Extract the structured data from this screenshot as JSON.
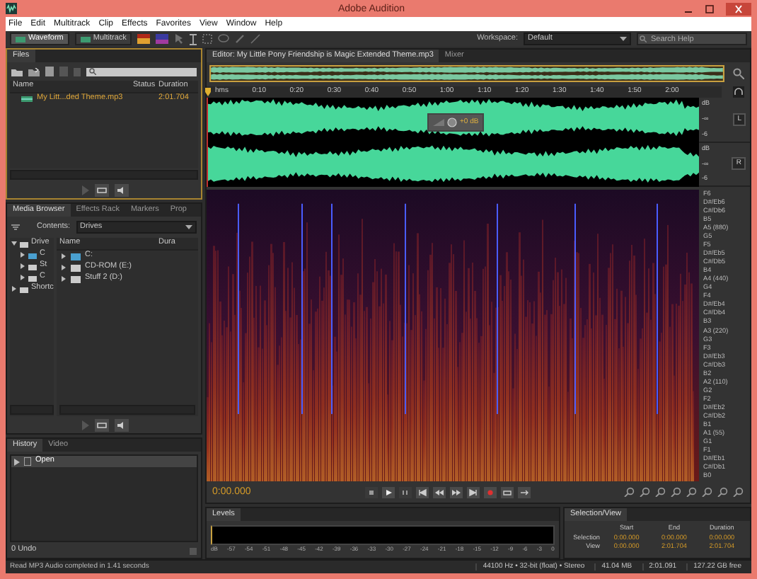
{
  "window": {
    "title": "Adobe Audition"
  },
  "menu": [
    "File",
    "Edit",
    "Multitrack",
    "Clip",
    "Effects",
    "Favorites",
    "View",
    "Window",
    "Help"
  ],
  "toolbar": {
    "modes": [
      {
        "label": "Waveform",
        "selected": true
      },
      {
        "label": "Multitrack",
        "selected": false
      }
    ],
    "workspace_label": "Workspace:",
    "workspace": "Default",
    "search": {
      "placeholder": "Search Help"
    }
  },
  "files_panel": {
    "tab": "Files",
    "columns": [
      "Name",
      "Status",
      "Duration"
    ],
    "rows": [
      {
        "name": "My Litt...ded Theme.mp3",
        "duration": "2:01.704",
        "selected": true
      }
    ]
  },
  "media_browser": {
    "tabs": [
      {
        "label": "Media Browser",
        "selected": true
      },
      {
        "label": "Effects Rack",
        "selected": false
      },
      {
        "label": "Markers",
        "selected": false
      },
      {
        "label": "Prop",
        "selected": false
      }
    ],
    "contents_label": "Contents:",
    "contents": "Drives",
    "tree": [
      {
        "label": "Drive",
        "expanded": true,
        "children": [
          {
            "label": "C",
            "expanded": false
          },
          {
            "label": "St",
            "expanded": false
          },
          {
            "label": "C",
            "expanded": false
          }
        ]
      },
      {
        "label": "Shortc",
        "expanded": false
      }
    ],
    "columns": [
      "Name",
      "Dura"
    ],
    "items": [
      {
        "label": "C:",
        "expanded": false
      },
      {
        "label": "CD-ROM (E:)",
        "expanded": false
      },
      {
        "label": "Stuff 2 (D:)",
        "expanded": false
      }
    ]
  },
  "history": {
    "tabs": [
      {
        "label": "History",
        "selected": true
      },
      {
        "label": "Video",
        "selected": false
      }
    ],
    "items": [
      {
        "label": "Open",
        "selected": true
      }
    ],
    "undo": "0 Undo"
  },
  "status_message": "Read MP3 Audio completed in 1.41 seconds",
  "editor": {
    "tabs": [
      {
        "label": "Editor: My Little Pony Friendship is Magic Extended Theme.mp3",
        "selected": true
      },
      {
        "label": "Mixer",
        "selected": false
      }
    ],
    "ruler": [
      "hms",
      "0:10",
      "0:20",
      "0:30",
      "0:40",
      "0:50",
      "1:00",
      "1:10",
      "1:20",
      "1:30",
      "1:40",
      "1:50",
      "2:00"
    ],
    "channels": [
      {
        "button": "L",
        "scale": [
          "dB",
          "-∞",
          "-6"
        ]
      },
      {
        "button": "R",
        "scale": [
          "dB",
          "-∞",
          "-6"
        ]
      }
    ],
    "hud_gain": "+0 dB",
    "note_labels": [
      "F6",
      "D#/Eb6",
      "C#/Db6",
      "B5",
      "A5 (880)",
      "G5",
      "F5",
      "D#/Eb5",
      "C#/Db5",
      "B4",
      "A4 (440)",
      "G4",
      "F4",
      "D#/Eb4",
      "C#/Db4",
      "B3",
      "A3 (220)",
      "G3",
      "F3",
      "D#/Eb3",
      "C#/Db3",
      "B2",
      "A2 (110)",
      "G2",
      "F2",
      "D#/Eb2",
      "C#/Db2",
      "B1",
      "A1 (55)",
      "G1",
      "F1",
      "D#/Eb1",
      "C#/Db1",
      "B0"
    ],
    "timecode": "0:00.000"
  },
  "levels": {
    "tab": "Levels",
    "scale": [
      "dB",
      "-57",
      "-54",
      "-51",
      "-48",
      "-45",
      "-42",
      "-39",
      "-36",
      "-33",
      "-30",
      "-27",
      "-24",
      "-21",
      "-18",
      "-15",
      "-12",
      "-9",
      "-6",
      "-3",
      "0"
    ]
  },
  "selection_view": {
    "tab": "Selection/View",
    "columns": [
      "Start",
      "End",
      "Duration"
    ],
    "rows": [
      {
        "label": "Selection",
        "values": [
          "0:00.000",
          "0:00.000",
          "0:00.000"
        ]
      },
      {
        "label": "View",
        "values": [
          "0:00.000",
          "2:01.704",
          "2:01.704"
        ]
      }
    ]
  },
  "status_bar": [
    "44100 Hz • 32-bit (float) • Stereo",
    "41.04 MB",
    "2:01.091",
    "127.22 GB free"
  ]
}
